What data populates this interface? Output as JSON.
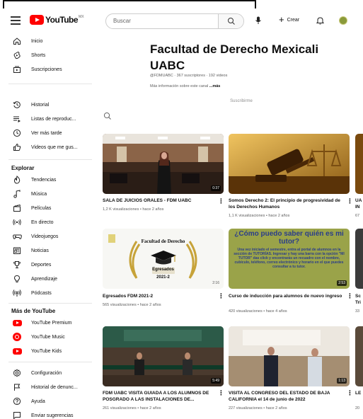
{
  "header": {
    "logo_text": "YouTube",
    "logo_sup": "MX",
    "search_placeholder": "Buscar",
    "create_label": "Crear"
  },
  "sidebar": {
    "main": [
      {
        "label": "Inicio",
        "icon": "home-icon"
      },
      {
        "label": "Shorts",
        "icon": "shorts-icon"
      },
      {
        "label": "Suscripciones",
        "icon": "subscriptions-icon"
      }
    ],
    "library": [
      {
        "label": "Historial",
        "icon": "history-icon"
      },
      {
        "label": "Listas de reproduc...",
        "icon": "playlist-icon"
      },
      {
        "label": "Ver más tarde",
        "icon": "clock-icon"
      },
      {
        "label": "Videos que me gus...",
        "icon": "thumbs-up-icon"
      }
    ],
    "explore_title": "Explorar",
    "explore": [
      {
        "label": "Tendencias",
        "icon": "trending-icon"
      },
      {
        "label": "Música",
        "icon": "music-icon"
      },
      {
        "label": "Películas",
        "icon": "movie-icon"
      },
      {
        "label": "En directo",
        "icon": "live-icon"
      },
      {
        "label": "Videojuegos",
        "icon": "gaming-icon"
      },
      {
        "label": "Noticias",
        "icon": "news-icon"
      },
      {
        "label": "Deportes",
        "icon": "trophy-icon"
      },
      {
        "label": "Aprendizaje",
        "icon": "lightbulb-icon"
      },
      {
        "label": "Pódcasts",
        "icon": "podcast-icon"
      }
    ],
    "more_title": "Más de YouTube",
    "more": [
      {
        "label": "YouTube Premium",
        "icon": "youtube-premium-icon"
      },
      {
        "label": "YouTube Music",
        "icon": "youtube-music-icon"
      },
      {
        "label": "YouTube Kids",
        "icon": "youtube-kids-icon"
      }
    ],
    "settings": [
      {
        "label": "Configuración",
        "icon": "gear-icon"
      },
      {
        "label": "Historial de denunc...",
        "icon": "flag-icon"
      },
      {
        "label": "Ayuda",
        "icon": "help-icon"
      },
      {
        "label": "Enviar sugerencias",
        "icon": "feedback-icon"
      }
    ]
  },
  "channel": {
    "title": "Facultad de Derecho Mexicali UABC",
    "handle": "@FDMUABC",
    "subscribers": "367 suscriptores",
    "videos": "192 videos",
    "more_info": "Más información sobre este canal",
    "more_link": "...más",
    "subscribe_label": "Suscribirme"
  },
  "videos": [
    {
      "title": "SALA DE JUICIOS ORALES - FDM UABC",
      "views": "1,2 K visualizaciones",
      "age": "hace 2 años",
      "duration": "0:37"
    },
    {
      "title": "Somos Derecho 2: El principio de progresividad de los Derechos Humanos",
      "views": "1,1 K visualizaciones",
      "age": "hace 2 años",
      "duration": ""
    },
    {
      "title": "Egresados FDM 2021-2",
      "views": "565 visualizaciones",
      "age": "hace 2 años",
      "duration": "2:16",
      "overlay_line1": "Facultad de Derecho",
      "overlay_line2": "Egresados",
      "overlay_line3": "2021-2"
    },
    {
      "title": "Curso de inducción para alumnos de nuevo ingreso",
      "views": "420 visualizaciones",
      "age": "hace 4 años",
      "duration": "2:53",
      "overlay_title": "¿Cómo puedo saber quién es mi tutor?",
      "overlay_body": "Una vez iniciado el semestre, entra al portal de alumnos en la sección de TUTORÍAS. Ingresar y hay una barra con la opción \"MI TUTOR\" das click y encontrarás un recuadro con el nombre, cubículo, teléfono, correo electrónico y horario en el que puedes consultar a tu tutor."
    },
    {
      "title": "FDM UABC VISITA GUIADA A LOS ALUMNOS DE POSGRADO A LAS INSTALACIONES DE...",
      "views": "261 visualizaciones",
      "age": "hace 2 años",
      "duration": "5:49"
    },
    {
      "title": "VISITA AL CONGRESO DEL ESTADO DE BAJA CALIFORNIA el 14 de junio de 2022",
      "views": "227 visualizaciones",
      "age": "hace 2 años",
      "duration": "1:13"
    }
  ],
  "partial_col": [
    {
      "title_l1": "UA",
      "title_l2": "IN",
      "meta": "67"
    },
    {
      "title_l1": "Sc",
      "title_l2": "Tri",
      "meta": "33"
    },
    {
      "title_l1": "LE",
      "title_l2": "",
      "meta": "20"
    }
  ],
  "colors": {
    "brand_red": "#ff0000",
    "text_primary": "#0f0f0f",
    "text_secondary": "#606060"
  }
}
